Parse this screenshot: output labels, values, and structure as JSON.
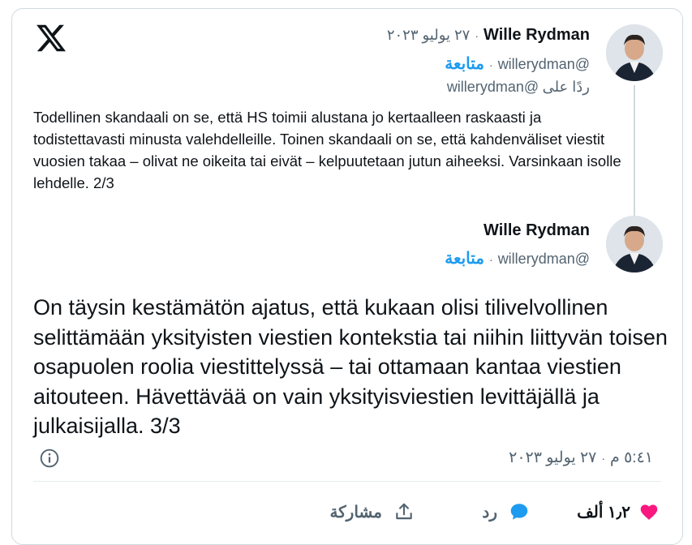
{
  "brand": {
    "logo_icon": "x-logo-icon"
  },
  "quoted_tweet": {
    "author_name": "Wille Rydman",
    "date": "٢٧ يوليو ٢٠٢٣",
    "handle": "@willerydman",
    "follow_label": "متابعة",
    "reply_to_prefix": "ردًا على",
    "reply_to_handle": "@willerydman",
    "text": "Todellinen skandaali on se, että HS toimii alustana jo kertaalleen raskaasti ja todistettavasti minusta valehdelleille. Toinen skandaali on se, että kahdenväliset viestit vuosien takaa – olivat ne oikeita tai eivät – kelpuutetaan jutun aiheeksi. Varsinkaan isolle lehdelle. 2/3"
  },
  "main_tweet": {
    "author_name": "Wille Rydman",
    "handle": "@willerydman",
    "follow_label": "متابعة",
    "text": "On täysin kestämätön ajatus, että kukaan olisi tilivelvollinen selittämään yksityisten viestien kontekstia tai niihin liittyvän toisen osapuolen roolia viestittelyssä – tai ottamaan kantaa viestien aitouteen. Hävettävää on vain yksityisviestien levittäjällä ja julkaisijalla. 3/3",
    "time": "٥:٤١ م",
    "date": "٢٧ يوليو ٢٠٢٣"
  },
  "actions": {
    "like_count": "١٫٢ ألف",
    "reply_label": "رد",
    "share_label": "مشاركة"
  },
  "colors": {
    "accent": "#1d9bf0",
    "like": "#f91880",
    "muted": "#536471",
    "text": "#0f1419",
    "border": "#cfd9de"
  }
}
